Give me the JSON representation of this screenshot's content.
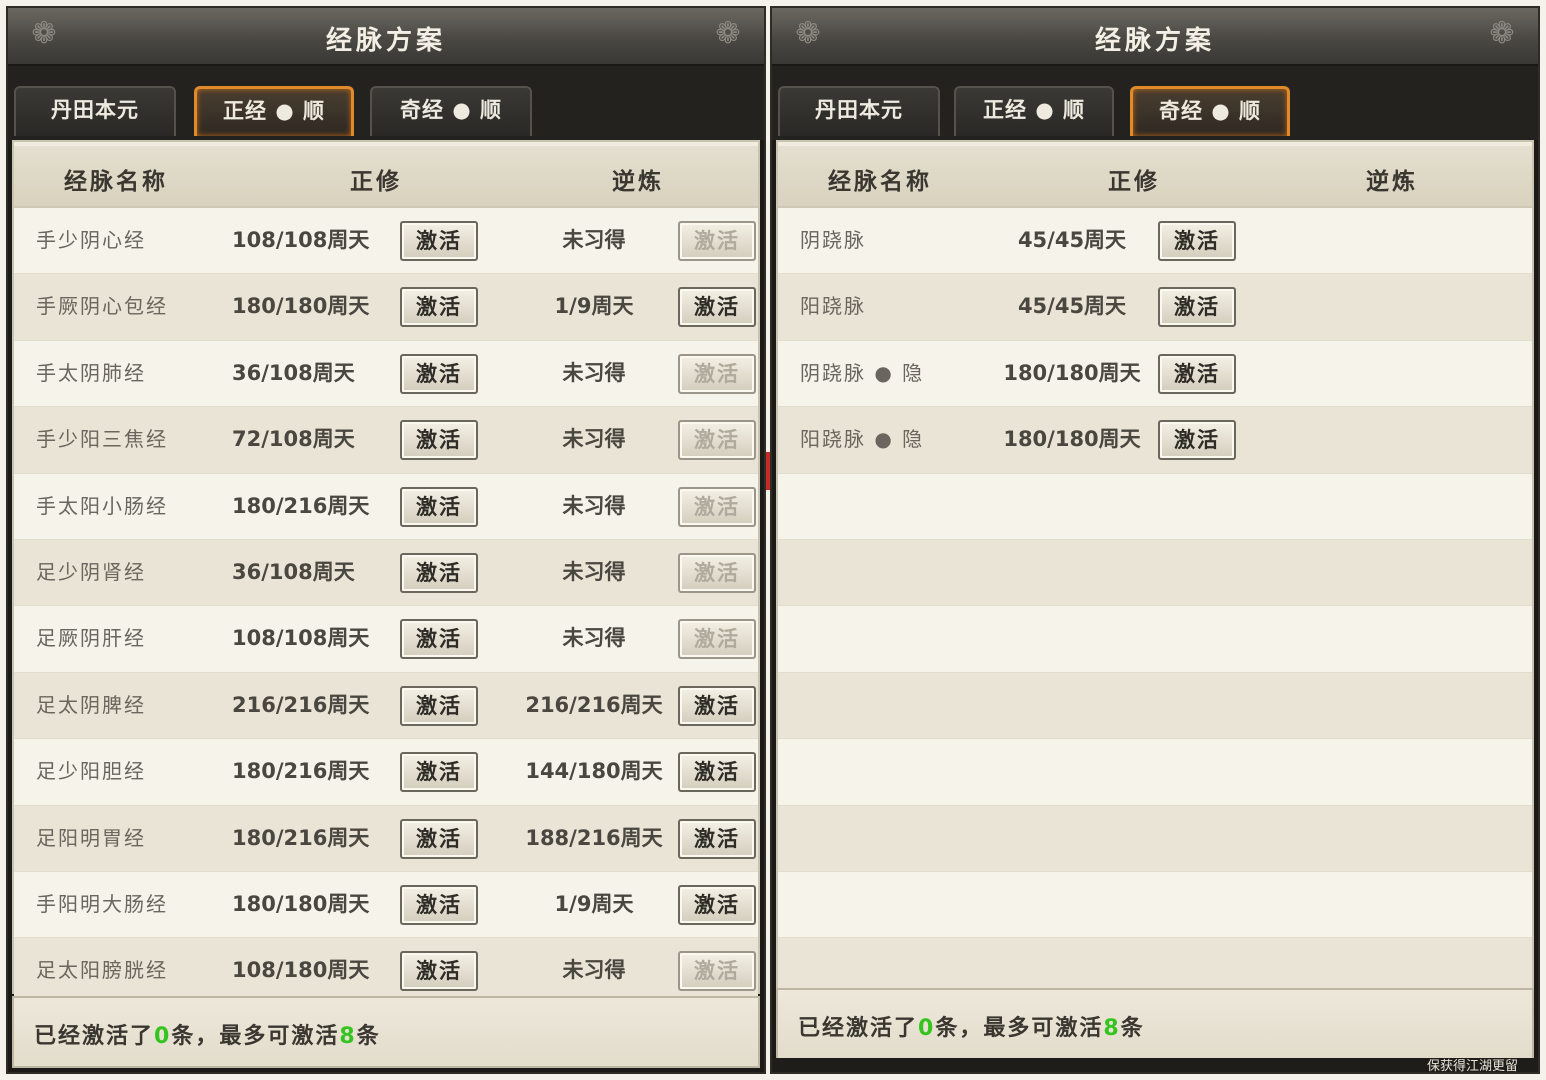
{
  "left": {
    "title": "经脉方案",
    "tabs": [
      {
        "label": "丹田本元",
        "active": false
      },
      {
        "label": "正经 ● 顺",
        "active": true
      },
      {
        "label": "奇经 ● 顺",
        "active": false
      }
    ],
    "headers": {
      "name": "经脉名称",
      "main": "正修",
      "reverse": "逆炼"
    },
    "button_label": "激活",
    "rows": [
      {
        "name": "手少阴心经",
        "main": "108/108周天",
        "reverse": "未习得",
        "reverse_btn_enabled": false
      },
      {
        "name": "手厥阴心包经",
        "main": "180/180周天",
        "reverse": "1/9周天",
        "reverse_btn_enabled": true
      },
      {
        "name": "手太阴肺经",
        "main": "36/108周天",
        "reverse": "未习得",
        "reverse_btn_enabled": false
      },
      {
        "name": "手少阳三焦经",
        "main": "72/108周天",
        "reverse": "未习得",
        "reverse_btn_enabled": false
      },
      {
        "name": "手太阳小肠经",
        "main": "180/216周天",
        "reverse": "未习得",
        "reverse_btn_enabled": false
      },
      {
        "name": "足少阴肾经",
        "main": "36/108周天",
        "reverse": "未习得",
        "reverse_btn_enabled": false
      },
      {
        "name": "足厥阴肝经",
        "main": "108/108周天",
        "reverse": "未习得",
        "reverse_btn_enabled": false
      },
      {
        "name": "足太阴脾经",
        "main": "216/216周天",
        "reverse": "216/216周天",
        "reverse_btn_enabled": true
      },
      {
        "name": "足少阳胆经",
        "main": "180/216周天",
        "reverse": "144/180周天",
        "reverse_btn_enabled": true
      },
      {
        "name": "足阳明胃经",
        "main": "180/216周天",
        "reverse": "188/216周天",
        "reverse_btn_enabled": true
      },
      {
        "name": "手阳明大肠经",
        "main": "180/180周天",
        "reverse": "1/9周天",
        "reverse_btn_enabled": true
      },
      {
        "name": "足太阳膀胱经",
        "main": "108/180周天",
        "reverse": "未习得",
        "reverse_btn_enabled": false
      }
    ],
    "footer": {
      "prefix": "已经激活了",
      "active_count": "0",
      "middle": "条，最多可激活",
      "max_count": "8",
      "suffix": "条"
    }
  },
  "right": {
    "title": "经脉方案",
    "tabs": [
      {
        "label": "丹田本元",
        "active": false
      },
      {
        "label": "正经 ● 顺",
        "active": false
      },
      {
        "label": "奇经 ● 顺",
        "active": true
      }
    ],
    "headers": {
      "name": "经脉名称",
      "main": "正修",
      "reverse": "逆炼"
    },
    "button_label": "激活",
    "rows": [
      {
        "name": "阴跷脉",
        "main": "45/45周天"
      },
      {
        "name": "阳跷脉",
        "main": "45/45周天"
      },
      {
        "name": "阴跷脉 ● 隐",
        "main": "180/180周天"
      },
      {
        "name": "阳跷脉 ● 隐",
        "main": "180/180周天"
      }
    ],
    "empty_rows": 8,
    "footer": {
      "prefix": "已经激活了",
      "active_count": "0",
      "middle": "条，最多可激活",
      "max_count": "8",
      "suffix": "条"
    },
    "bottom_text": "保获得江湖更留"
  },
  "colors": {
    "accent_tab": "#e08a2c",
    "count_green": "#35c41f"
  },
  "icons": {
    "title_ornament": "cloud-swirl-icon"
  }
}
